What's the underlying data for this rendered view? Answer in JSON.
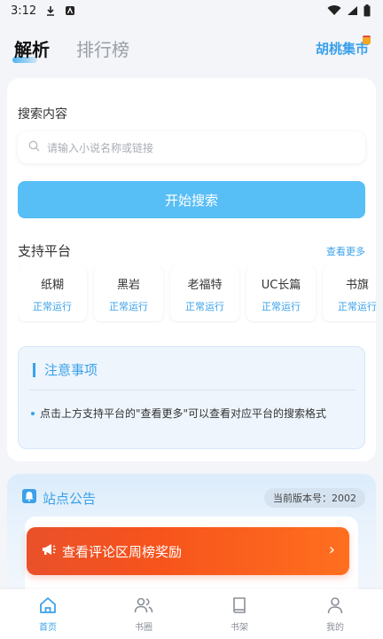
{
  "status_bar": {
    "time": "3:12"
  },
  "top_tabs": {
    "active": "解析",
    "inactive": "排行榜",
    "market": "胡桃集市"
  },
  "search": {
    "label": "搜索内容",
    "placeholder": "请输入小说名称或链接",
    "button": "开始搜索"
  },
  "platforms": {
    "title": "支持平台",
    "see_more": "查看更多",
    "items": [
      {
        "name": "纸糊",
        "status": "正常运行"
      },
      {
        "name": "黑岩",
        "status": "正常运行"
      },
      {
        "name": "老福特",
        "status": "正常运行"
      },
      {
        "name": "UC长篇",
        "status": "正常运行"
      },
      {
        "name": "书旗",
        "status": "正常运行"
      }
    ]
  },
  "notice": {
    "title": "注意事项",
    "item": "点击上方支持平台的\"查看更多\"可以查看对应平台的搜索格式"
  },
  "announcement": {
    "title": "站点公告",
    "version": "当前版本号：2002",
    "promo": "查看评论区周榜奖励"
  },
  "bottom_nav": [
    {
      "label": "首页",
      "icon": "home-icon",
      "active": true
    },
    {
      "label": "书圈",
      "icon": "users-icon",
      "active": false
    },
    {
      "label": "书架",
      "icon": "book-icon",
      "active": false
    },
    {
      "label": "我的",
      "icon": "user-icon",
      "active": false
    }
  ],
  "colors": {
    "accent": "#3aa1ea",
    "button": "#58bef6",
    "promo": "#f7531c"
  }
}
